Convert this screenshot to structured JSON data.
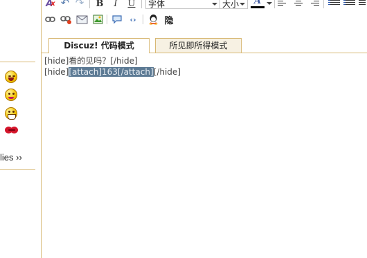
{
  "sidebar": {
    "replies_label": "lies ››",
    "smileys": [
      "laughing-face-icon",
      "shy-face-icon",
      "grinning-face-icon",
      "kiss-lips-icon"
    ]
  },
  "toolbar": {
    "icons": [
      "remove-format-icon",
      "undo-icon",
      "redo-icon"
    ],
    "bold_label": "B",
    "italic_label": "I",
    "underline_label": "U",
    "font_select_value": "字体",
    "size_select_value": "大小",
    "color_label": "A",
    "align_icons": [
      "align-left-icon",
      "align-center-icon",
      "align-right-icon"
    ],
    "list_icons": [
      "ordered-list-icon",
      "unordered-list-icon"
    ],
    "row2_icons": [
      "link-icon",
      "unlink-icon",
      "email-icon",
      "image-icon",
      "quote-icon",
      "code-icon",
      "qq-icon"
    ],
    "hide_label": "隐"
  },
  "tabs": {
    "code_mode": "Discuz! 代码模式",
    "wysiwyg_mode": "所见即所得模式"
  },
  "editor": {
    "line1": "[hide]看的见吗？[/hide]",
    "line2_before": "[hide]",
    "line2_selected": "[attach]163[/attach]",
    "line2_after": "[/hide]"
  }
}
